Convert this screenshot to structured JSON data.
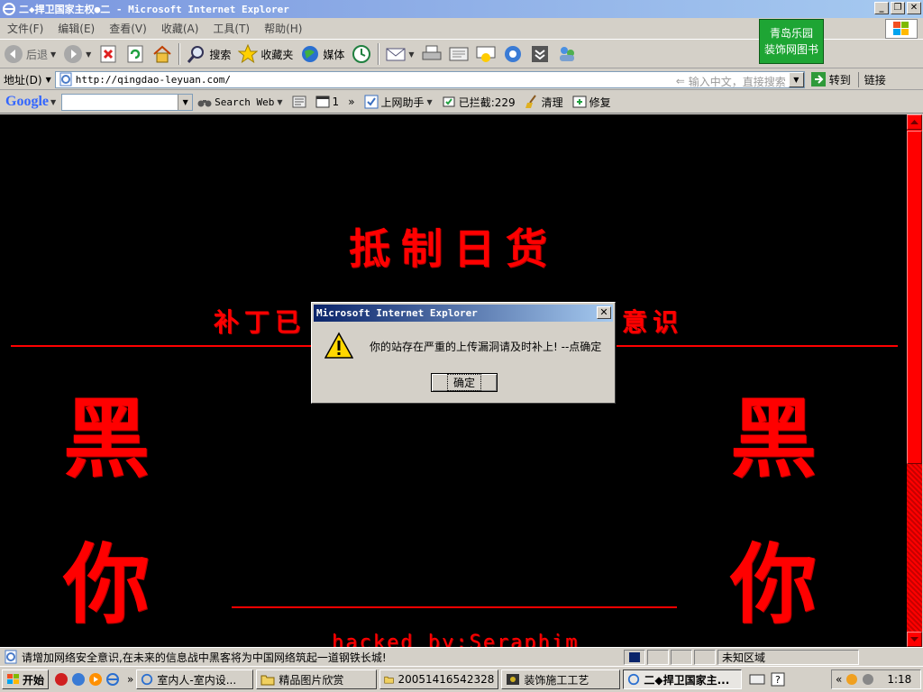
{
  "window": {
    "title": "二◆捍卫国家主权●二 - Microsoft Internet Explorer",
    "buttons": [
      "_",
      "❐",
      "✕"
    ]
  },
  "menu": [
    "文件(F)",
    "编辑(E)",
    "查看(V)",
    "收藏(A)",
    "工具(T)",
    "帮助(H)"
  ],
  "promo": {
    "line1": "青岛乐园",
    "line2": "装饰网图书"
  },
  "toolbar": {
    "back": "后退",
    "search": "搜索",
    "favorites": "收藏夹",
    "media": "媒体"
  },
  "address": {
    "label": "地址(D)",
    "url": "http://qingdao-leyuan.com/",
    "search_hint": "输入中文，直接搜索",
    "go": "转到",
    "links": "链接"
  },
  "google": {
    "logo": "Google",
    "search_web": "Search Web",
    "item_1": "1",
    "helper": "上网助手",
    "blocked": "已拦截:229",
    "clean": "清理",
    "repair": "修复"
  },
  "page": {
    "heading": "抵制日货",
    "subline_left": "补丁已",
    "subline_right": "意识",
    "big_left_1": "黑",
    "big_left_2": "你",
    "big_right_1": "黑",
    "big_right_2": "你",
    "hacked": "hacked by:Seraphim"
  },
  "dialog": {
    "title": "Microsoft Internet Explorer",
    "message": "你的站存在严重的上传漏洞请及时补上! --点确定",
    "ok": "确定"
  },
  "status": {
    "text": "请增加网络安全意识,在未来的信息战中黑客将为中国网络筑起一道钢铁长城!",
    "zone": "未知区域"
  },
  "taskbar": {
    "start": "开始",
    "tasks": [
      "室内人-室内设...",
      "精品图片欣赏",
      "20051416542328",
      "装饰施工工艺",
      "二◆捍卫国家主..."
    ],
    "clock": "1:18"
  },
  "colors": {
    "page_bg": "#000000",
    "accent_red": "#ff0000",
    "promo_green": "#1ea534",
    "title_blue": "#0a246a"
  }
}
